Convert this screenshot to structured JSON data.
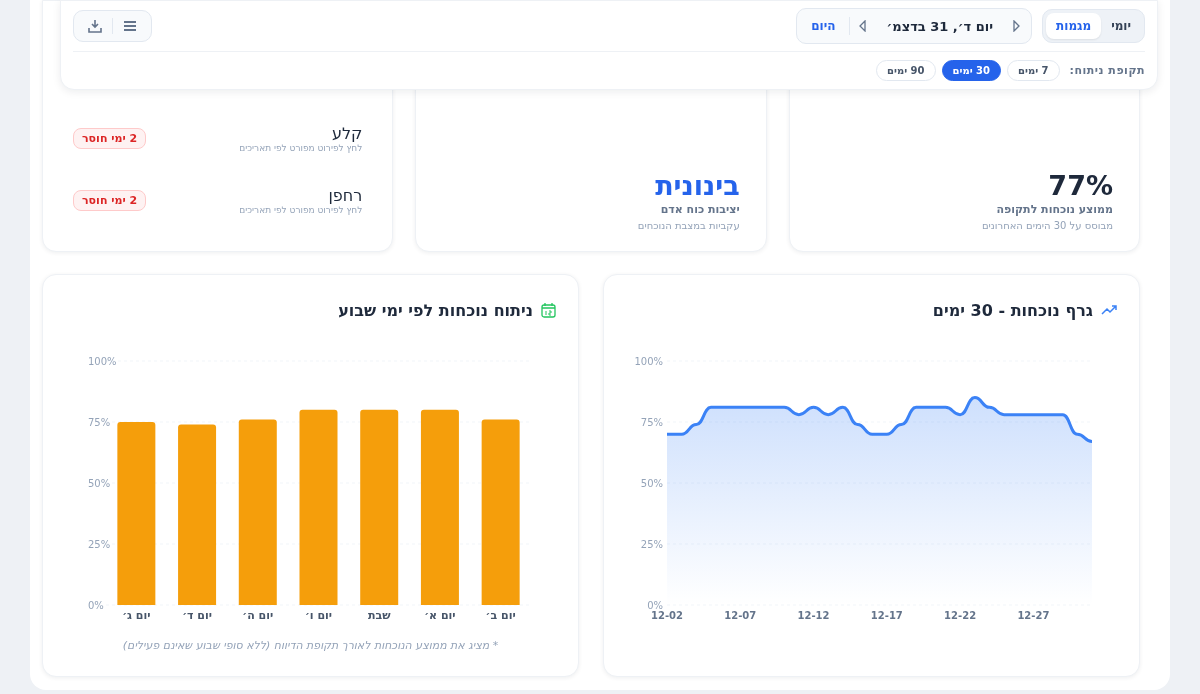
{
  "header": {
    "view_toggle": [
      {
        "label": "יומי",
        "selected": false
      },
      {
        "label": "מגמות",
        "selected": true
      }
    ],
    "date_nav": {
      "date": "יום ד׳, 31 בדצמ׳",
      "today": "היום"
    },
    "period": {
      "label": "תקופת ניתוח:",
      "options": [
        {
          "label": "7 ימים",
          "selected": false
        },
        {
          "label": "30 ימים",
          "selected": true
        },
        {
          "label": "90 ימים",
          "selected": false
        }
      ]
    }
  },
  "stats": [
    {
      "kind": "metric",
      "value": "77%",
      "title": "ממוצע נוכחות לתקופה",
      "subtitle": "מבוסס על 30 הימים האחרונים",
      "color": "#1e293b"
    },
    {
      "kind": "metric",
      "value": "בינונית",
      "title": "יציבות כוח אדם",
      "subtitle": "עקביות במצבת הנוכחים",
      "color": "#2563eb"
    },
    {
      "kind": "list",
      "rows": [
        {
          "name": "קלע",
          "hint": "לחץ לפירוט מפורט לפי תאריכים",
          "badge": "2 ימי חוסר"
        },
        {
          "name": "רחפן",
          "hint": "לחץ לפירוט מפורט לפי תאריכים",
          "badge": "2 ימי חוסר"
        }
      ]
    }
  ],
  "trend": {
    "title": "גרף נוכחות - 30 ימים",
    "chart_data": {
      "type": "area",
      "grid": true,
      "categories": [
        "12-02",
        null,
        null,
        null,
        null,
        "12-07",
        null,
        null,
        null,
        null,
        "12-12",
        null,
        null,
        null,
        null,
        "12-17",
        null,
        null,
        null,
        null,
        "12-22",
        null,
        null,
        null,
        null,
        "12-27",
        null,
        null,
        null,
        null
      ],
      "series": [
        {
          "color": "#3b82f6",
          "values": [
            70,
            70,
            74,
            81,
            81,
            81,
            81,
            81,
            81,
            78,
            81,
            78,
            81,
            74,
            70,
            70,
            74,
            81,
            81,
            81,
            78,
            85,
            81,
            78,
            78,
            78,
            78,
            78,
            70,
            67
          ]
        }
      ],
      "ylim": [
        0,
        100
      ],
      "yticks": [
        {
          "value": 0,
          "label": "0%"
        },
        {
          "value": 25,
          "label": "25%"
        },
        {
          "value": 50,
          "label": "50%"
        },
        {
          "value": 75,
          "label": "75%"
        },
        {
          "value": 100,
          "label": "100%"
        }
      ]
    }
  },
  "weekday": {
    "title": "ניתוח נוכחות לפי ימי שבוע",
    "note": "* מציג את ממוצע הנוכחות לאורך תקופת הדיווח (ללא סופי שבוע שאינם פעילים)",
    "chart_data": {
      "type": "bar",
      "grid": true,
      "categories": [
        "יום ג׳",
        "יום ד׳",
        "יום ה׳",
        "יום ו׳",
        "שבת",
        "יום א׳",
        "יום ב׳"
      ],
      "series": [
        {
          "color": "#f59e0b",
          "values": [
            75,
            74,
            76,
            80,
            80,
            80,
            76
          ]
        }
      ],
      "ylim": [
        0,
        100
      ],
      "yticks": [
        {
          "value": 0,
          "label": "0%"
        },
        {
          "value": 25,
          "label": "25%"
        },
        {
          "value": 50,
          "label": "50%"
        },
        {
          "value": 75,
          "label": "75%"
        },
        {
          "value": 100,
          "label": "100%"
        }
      ]
    }
  }
}
